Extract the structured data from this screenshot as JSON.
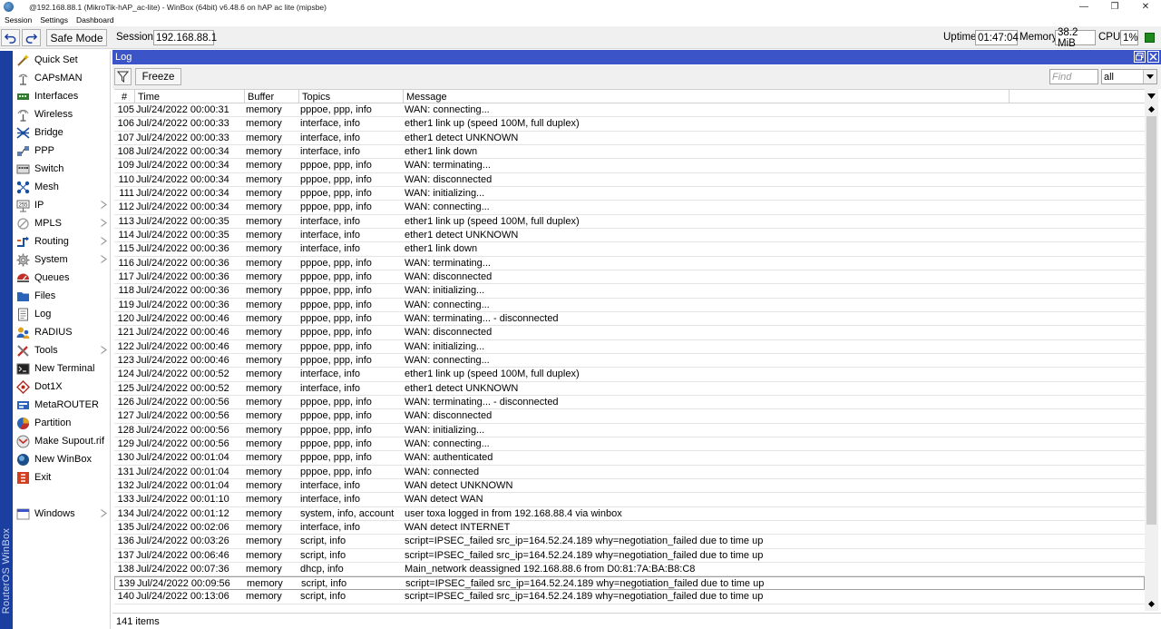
{
  "window": {
    "title": "@192.168.88.1 (MikroTik-hAP_ac-lite) - WinBox (64bit) v6.48.6 on hAP ac lite (mipsbe)",
    "minimize": "—",
    "restore": "❐",
    "close": "✕"
  },
  "menubar": [
    "Session",
    "Settings",
    "Dashboard"
  ],
  "toolbar": {
    "safe_mode_label": "Safe Mode",
    "session_label": "Session:",
    "session_value": "192.168.88.1",
    "uptime_label": "Uptime:",
    "uptime_value": "01:47:04",
    "memory_label": "Memory:",
    "memory_value": "38.2 MiB",
    "cpu_label": "CPU:",
    "cpu_value": "1%",
    "status_color": "#1e8a1e"
  },
  "brand": "RouterOS WinBox",
  "sidebar": {
    "items": [
      {
        "label": "Quick Set",
        "icon": "wand-icon"
      },
      {
        "label": "CAPsMAN",
        "icon": "antenna-icon"
      },
      {
        "label": "Interfaces",
        "icon": "interfaces-icon"
      },
      {
        "label": "Wireless",
        "icon": "wireless-icon"
      },
      {
        "label": "Bridge",
        "icon": "bridge-icon"
      },
      {
        "label": "PPP",
        "icon": "ppp-icon"
      },
      {
        "label": "Switch",
        "icon": "switch-icon"
      },
      {
        "label": "Mesh",
        "icon": "mesh-icon"
      },
      {
        "label": "IP",
        "icon": "ip-icon",
        "submenu": true
      },
      {
        "label": "MPLS",
        "icon": "mpls-icon",
        "submenu": true
      },
      {
        "label": "Routing",
        "icon": "routing-icon",
        "submenu": true
      },
      {
        "label": "System",
        "icon": "gear-icon",
        "submenu": true
      },
      {
        "label": "Queues",
        "icon": "queues-icon"
      },
      {
        "label": "Files",
        "icon": "folder-icon"
      },
      {
        "label": "Log",
        "icon": "log-icon"
      },
      {
        "label": "RADIUS",
        "icon": "radius-icon"
      },
      {
        "label": "Tools",
        "icon": "tools-icon",
        "submenu": true
      },
      {
        "label": "New Terminal",
        "icon": "terminal-icon"
      },
      {
        "label": "Dot1X",
        "icon": "dot1x-icon"
      },
      {
        "label": "MetaROUTER",
        "icon": "metarouter-icon"
      },
      {
        "label": "Partition",
        "icon": "partition-icon"
      },
      {
        "label": "Make Supout.rif",
        "icon": "supout-icon"
      },
      {
        "label": "New WinBox",
        "icon": "winbox-icon"
      },
      {
        "label": "Exit",
        "icon": "exit-icon"
      }
    ],
    "windows_label": "Windows"
  },
  "log": {
    "title": "Log",
    "freeze_label": "Freeze",
    "find_placeholder": "Find",
    "filter_value": "all",
    "columns": [
      "#",
      "Time",
      "Buffer",
      "Topics",
      "Message"
    ],
    "rows": [
      [
        "105",
        "Jul/24/2022 00:00:31",
        "memory",
        "pppoe, ppp, info",
        "WAN: connecting..."
      ],
      [
        "106",
        "Jul/24/2022 00:00:33",
        "memory",
        "interface, info",
        "ether1 link up (speed 100M, full duplex)"
      ],
      [
        "107",
        "Jul/24/2022 00:00:33",
        "memory",
        "interface, info",
        "ether1 detect UNKNOWN"
      ],
      [
        "108",
        "Jul/24/2022 00:00:34",
        "memory",
        "interface, info",
        "ether1 link down"
      ],
      [
        "109",
        "Jul/24/2022 00:00:34",
        "memory",
        "pppoe, ppp, info",
        "WAN: terminating..."
      ],
      [
        "110",
        "Jul/24/2022 00:00:34",
        "memory",
        "pppoe, ppp, info",
        "WAN: disconnected"
      ],
      [
        "111",
        "Jul/24/2022 00:00:34",
        "memory",
        "pppoe, ppp, info",
        "WAN: initializing..."
      ],
      [
        "112",
        "Jul/24/2022 00:00:34",
        "memory",
        "pppoe, ppp, info",
        "WAN: connecting..."
      ],
      [
        "113",
        "Jul/24/2022 00:00:35",
        "memory",
        "interface, info",
        "ether1 link up (speed 100M, full duplex)"
      ],
      [
        "114",
        "Jul/24/2022 00:00:35",
        "memory",
        "interface, info",
        "ether1 detect UNKNOWN"
      ],
      [
        "115",
        "Jul/24/2022 00:00:36",
        "memory",
        "interface, info",
        "ether1 link down"
      ],
      [
        "116",
        "Jul/24/2022 00:00:36",
        "memory",
        "pppoe, ppp, info",
        "WAN: terminating..."
      ],
      [
        "117",
        "Jul/24/2022 00:00:36",
        "memory",
        "pppoe, ppp, info",
        "WAN: disconnected"
      ],
      [
        "118",
        "Jul/24/2022 00:00:36",
        "memory",
        "pppoe, ppp, info",
        "WAN: initializing..."
      ],
      [
        "119",
        "Jul/24/2022 00:00:36",
        "memory",
        "pppoe, ppp, info",
        "WAN: connecting..."
      ],
      [
        "120",
        "Jul/24/2022 00:00:46",
        "memory",
        "pppoe, ppp, info",
        "WAN: terminating... - disconnected"
      ],
      [
        "121",
        "Jul/24/2022 00:00:46",
        "memory",
        "pppoe, ppp, info",
        "WAN: disconnected"
      ],
      [
        "122",
        "Jul/24/2022 00:00:46",
        "memory",
        "pppoe, ppp, info",
        "WAN: initializing..."
      ],
      [
        "123",
        "Jul/24/2022 00:00:46",
        "memory",
        "pppoe, ppp, info",
        "WAN: connecting..."
      ],
      [
        "124",
        "Jul/24/2022 00:00:52",
        "memory",
        "interface, info",
        "ether1 link up (speed 100M, full duplex)"
      ],
      [
        "125",
        "Jul/24/2022 00:00:52",
        "memory",
        "interface, info",
        "ether1 detect UNKNOWN"
      ],
      [
        "126",
        "Jul/24/2022 00:00:56",
        "memory",
        "pppoe, ppp, info",
        "WAN: terminating... - disconnected"
      ],
      [
        "127",
        "Jul/24/2022 00:00:56",
        "memory",
        "pppoe, ppp, info",
        "WAN: disconnected"
      ],
      [
        "128",
        "Jul/24/2022 00:00:56",
        "memory",
        "pppoe, ppp, info",
        "WAN: initializing..."
      ],
      [
        "129",
        "Jul/24/2022 00:00:56",
        "memory",
        "pppoe, ppp, info",
        "WAN: connecting..."
      ],
      [
        "130",
        "Jul/24/2022 00:01:04",
        "memory",
        "pppoe, ppp, info",
        "WAN: authenticated"
      ],
      [
        "131",
        "Jul/24/2022 00:01:04",
        "memory",
        "pppoe, ppp, info",
        "WAN: connected"
      ],
      [
        "132",
        "Jul/24/2022 00:01:04",
        "memory",
        "interface, info",
        "WAN detect UNKNOWN"
      ],
      [
        "133",
        "Jul/24/2022 00:01:10",
        "memory",
        "interface, info",
        "WAN detect WAN"
      ],
      [
        "134",
        "Jul/24/2022 00:01:12",
        "memory",
        "system, info, account",
        "user toxa logged in from 192.168.88.4 via winbox"
      ],
      [
        "135",
        "Jul/24/2022 00:02:06",
        "memory",
        "interface, info",
        "WAN detect INTERNET"
      ],
      [
        "136",
        "Jul/24/2022 00:03:26",
        "memory",
        "script, info",
        "script=IPSEC_failed src_ip=164.52.24.189 why=negotiation_failed due to time up"
      ],
      [
        "137",
        "Jul/24/2022 00:06:46",
        "memory",
        "script, info",
        "script=IPSEC_failed src_ip=164.52.24.189 why=negotiation_failed due to time up"
      ],
      [
        "138",
        "Jul/24/2022 00:07:36",
        "memory",
        "dhcp, info",
        "Main_network deassigned 192.168.88.6 from D0:81:7A:BA:B8:C8"
      ],
      [
        "139",
        "Jul/24/2022 00:09:56",
        "memory",
        "script, info",
        "script=IPSEC_failed src_ip=164.52.24.189 why=negotiation_failed due to time up"
      ],
      [
        "140",
        "Jul/24/2022 00:13:06",
        "memory",
        "script, info",
        "script=IPSEC_failed src_ip=164.52.24.189 why=negotiation_failed due to time up"
      ]
    ],
    "selected_row": 34,
    "item_count": "141 items"
  }
}
